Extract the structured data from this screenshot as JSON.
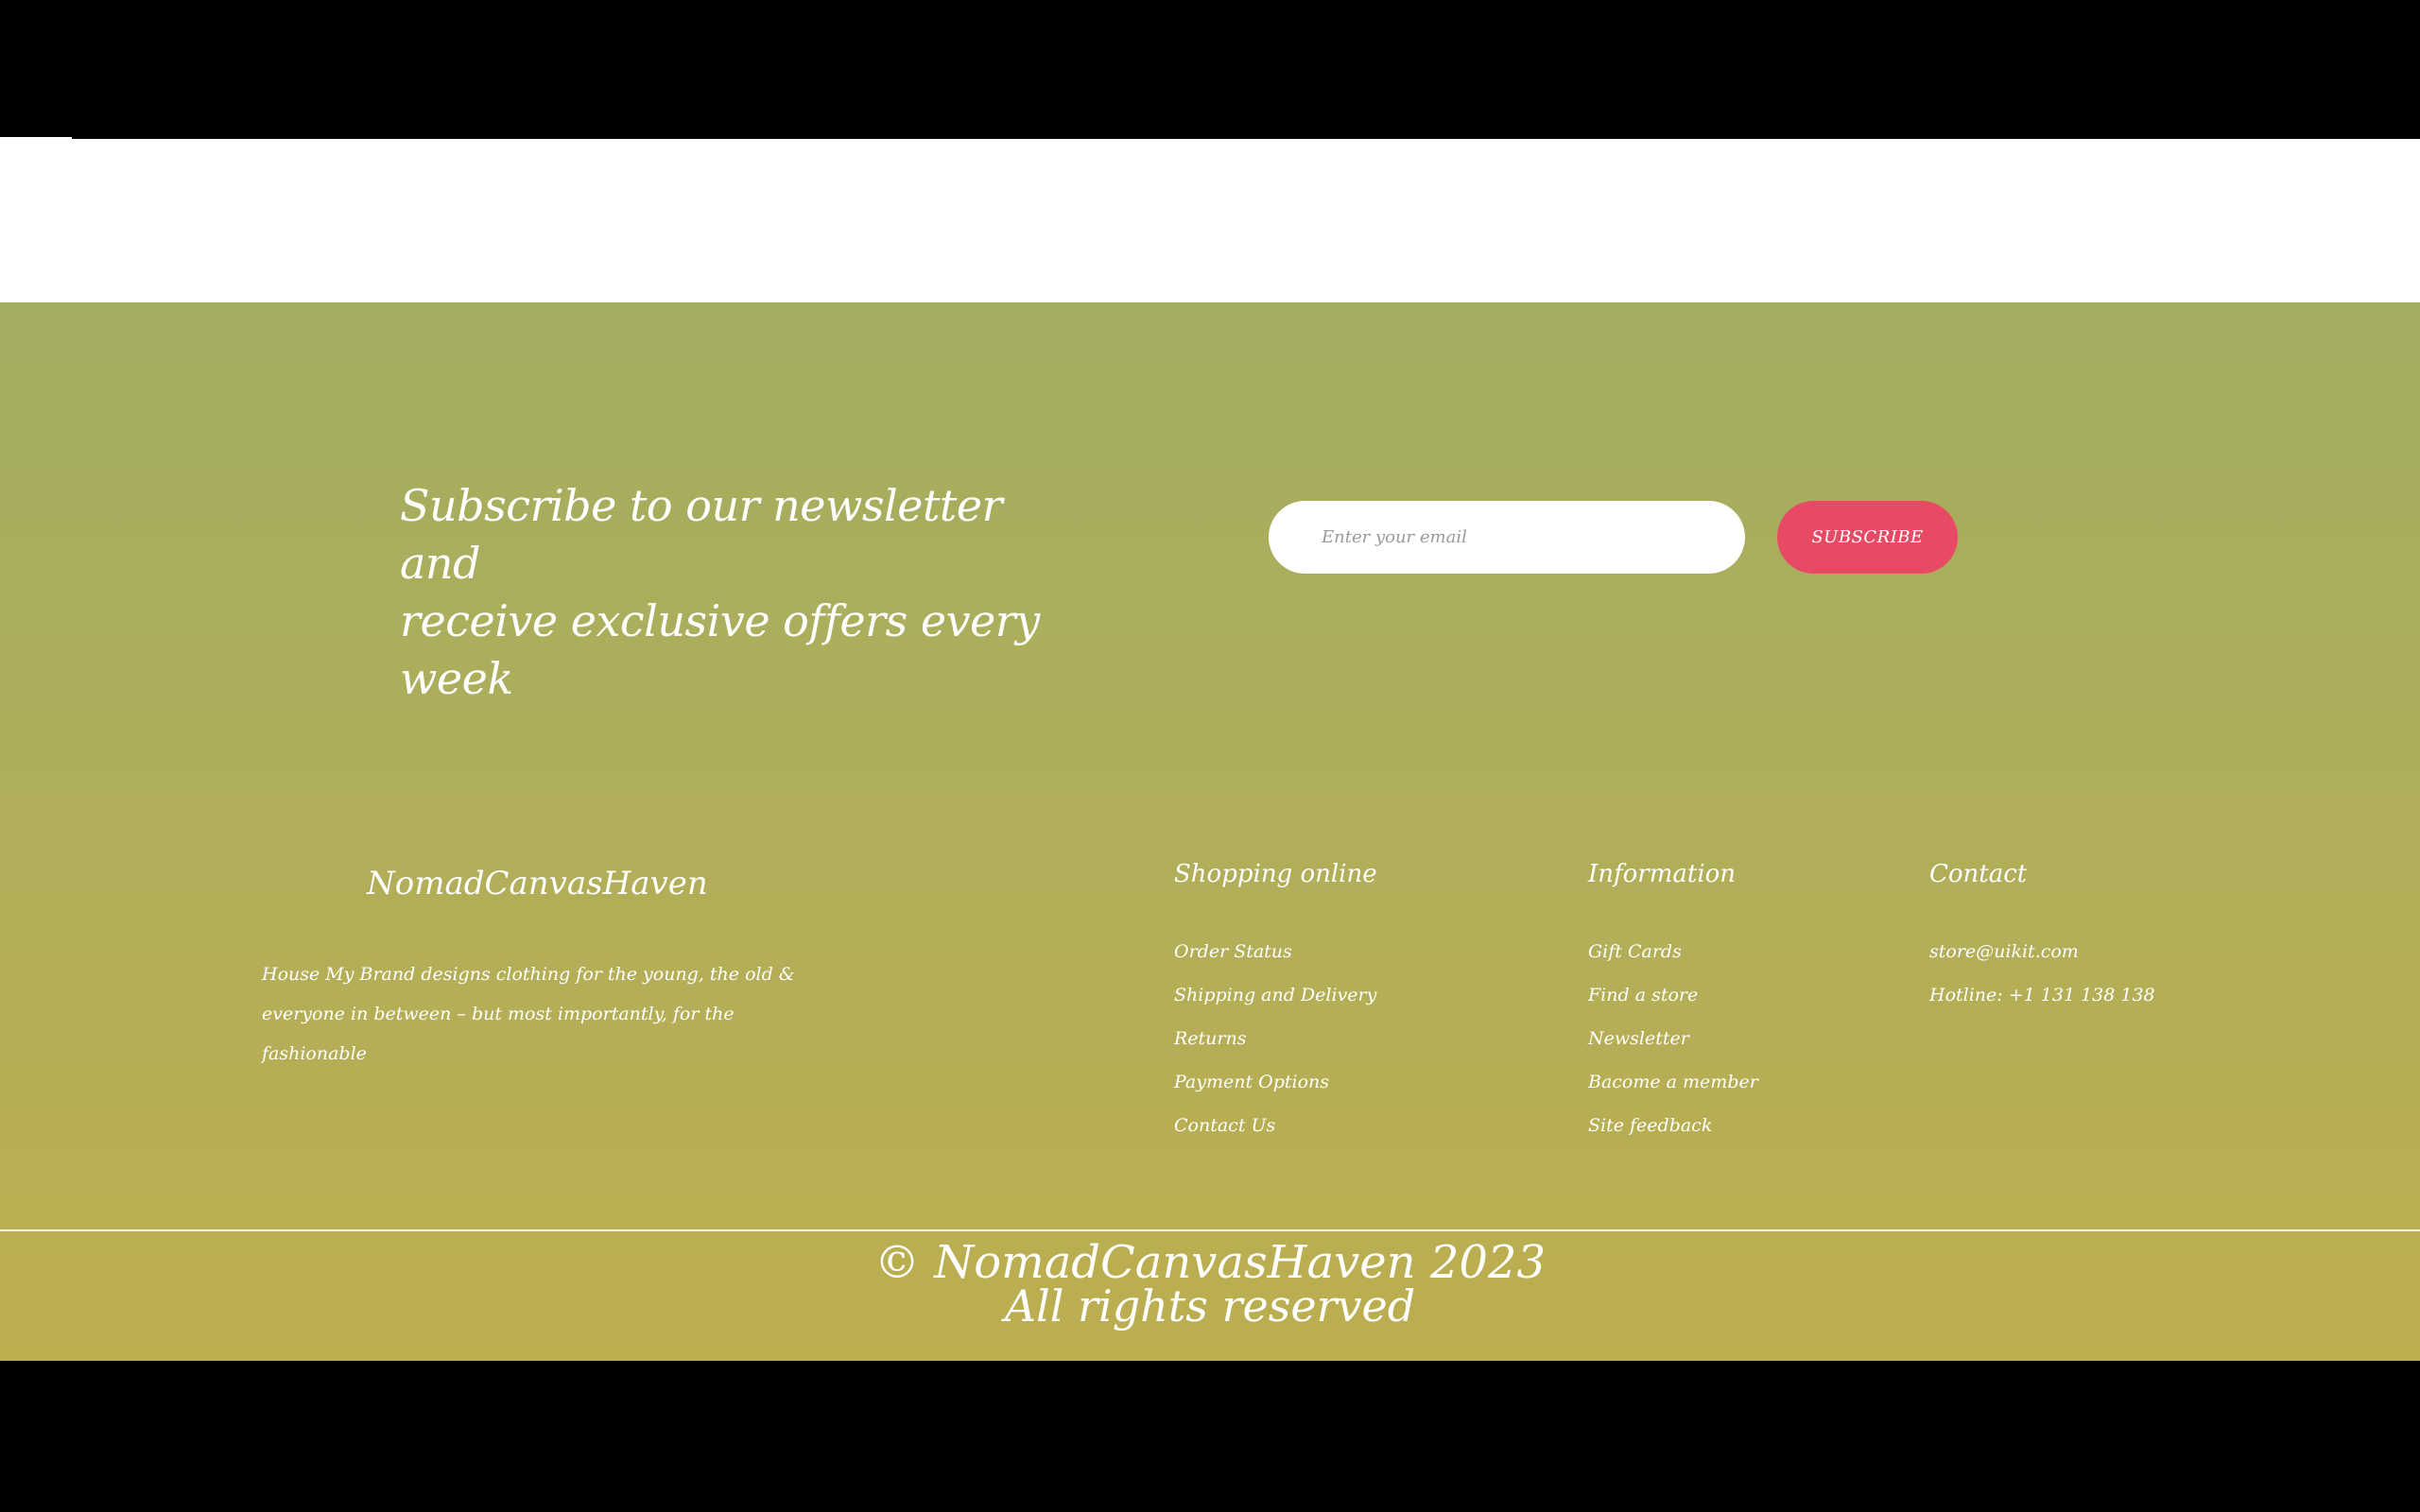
{
  "newsletter": {
    "heading_line1": "Subscribe to our newsletter and",
    "heading_line2": "receive exclusive offers every week",
    "email_placeholder": "Enter your email",
    "subscribe_label": "SUBSCRIBE"
  },
  "brand": {
    "name": "NomadCanvasHaven",
    "description_line1": "House My Brand designs clothing for the young, the old &",
    "description_line2": "everyone in between – but most importantly, for the fashionable"
  },
  "columns": {
    "shipping": {
      "title": "Shopping online",
      "links": [
        "Order Status",
        "Shipping and Delivery",
        "Returns",
        "Payment Options",
        "Contact Us"
      ]
    },
    "information": {
      "title": "Information",
      "links": [
        "Gift Cards",
        "Find a store",
        "Newsletter",
        "Bacome a member",
        "Site feedback"
      ]
    },
    "contact": {
      "title": "Contact",
      "links": [
        "store@uikit.com",
        "Hotline: +1 131 138 138"
      ]
    }
  },
  "copyright": {
    "line1": "© NomadCanvasHaven 2023",
    "line2": "All rights reserved"
  },
  "colors": {
    "gradient_top": "#a3ad60",
    "gradient_bottom": "#bcae4f",
    "subscribe_button": "#e84a66",
    "text": "#ffffff"
  }
}
